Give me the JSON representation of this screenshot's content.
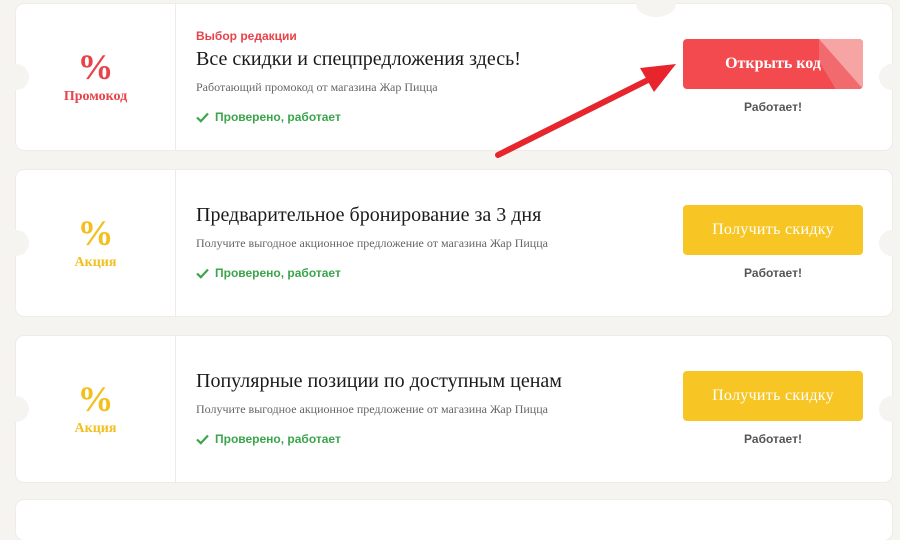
{
  "coupons": [
    {
      "percent": "%",
      "type_label": "Промокод",
      "editor_choice": "Выбор редакции",
      "title": "Все скидки и спецпредложения здесь!",
      "description": "Работающий промокод от магазина Жар Пицца",
      "verified": "Проверено, работает",
      "button_label": "Открыть код",
      "status": "Работает!"
    },
    {
      "percent": "%",
      "type_label": "Акция",
      "title": "Предварительное бронирование за 3 дня",
      "description": "Получите выгодное акционное предложение от магазина Жар Пицца",
      "verified": "Проверено, работает",
      "button_label": "Получить скидку",
      "status": "Работает!"
    },
    {
      "percent": "%",
      "type_label": "Акция",
      "title": "Популярные позиции по доступным ценам",
      "description": "Получите выгодное акционное предложение от магазина Жар Пицца",
      "verified": "Проверено, работает",
      "button_label": "Получить скидку",
      "status": "Работает!"
    }
  ],
  "colors": {
    "promo_red": "#e8424a",
    "action_yellow": "#f2c01e",
    "verified_green": "#3aa54b",
    "arrow_red": "#e8242c"
  },
  "icons": {
    "verified": "checkmark-icon",
    "annotation": "red-arrow-pointer"
  }
}
